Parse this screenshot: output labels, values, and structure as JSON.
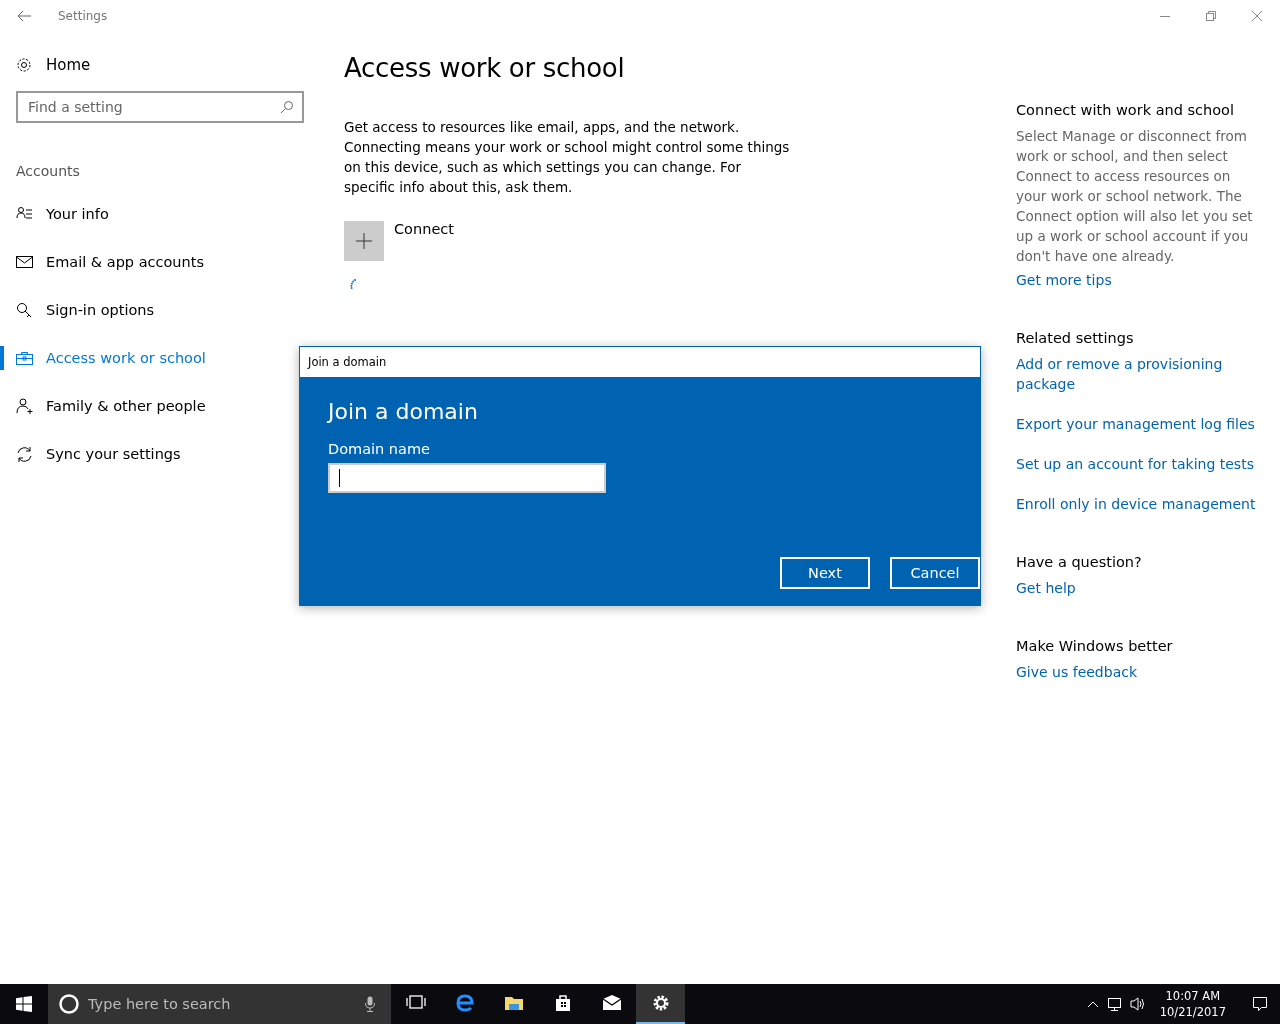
{
  "window": {
    "title": "Settings"
  },
  "sidebar": {
    "home": "Home",
    "search": {
      "placeholder": "Find a setting"
    },
    "section": "Accounts",
    "items": [
      {
        "label": "Your info",
        "selected": false
      },
      {
        "label": "Email & app accounts",
        "selected": false
      },
      {
        "label": "Sign-in options",
        "selected": false
      },
      {
        "label": "Access work or school",
        "selected": true
      },
      {
        "label": "Family & other people",
        "selected": false
      },
      {
        "label": "Sync your settings",
        "selected": false
      }
    ]
  },
  "main": {
    "title": "Access work or school",
    "description": "Get access to resources like email, apps, and the network. Connecting means your work or school might control some things on this device, such as which settings you can change. For specific info about this, ask them.",
    "connect": "Connect"
  },
  "dialog": {
    "title": "Join a domain",
    "heading": "Join a domain",
    "field_label": "Domain name",
    "buttons": [
      "Next",
      "Cancel"
    ]
  },
  "aside": {
    "sections": [
      {
        "heading": "Connect with work and school",
        "text": "Select Manage or disconnect from work or school, and then select Connect to access resources on your work or school network. The Connect option will also let you set up a work or school account if you don't have one already.",
        "links": [
          "Get more tips"
        ]
      },
      {
        "heading": "Related settings",
        "links": [
          "Add or remove a provisioning package",
          "Export your management log files",
          "Set up an account for taking tests",
          "Enroll only in device management"
        ]
      },
      {
        "heading": "Have a question?",
        "links": [
          "Get help"
        ]
      },
      {
        "heading": "Make Windows better",
        "links": [
          "Give us feedback"
        ]
      }
    ]
  },
  "taskbar": {
    "search": {
      "placeholder": "Type here to search"
    },
    "apps": [
      {
        "selected": false
      },
      {
        "selected": false
      },
      {
        "selected": false
      },
      {
        "selected": false
      },
      {
        "selected": false
      },
      {
        "selected": true
      }
    ],
    "time": "10:07 AM",
    "date": "10/21/2017"
  }
}
